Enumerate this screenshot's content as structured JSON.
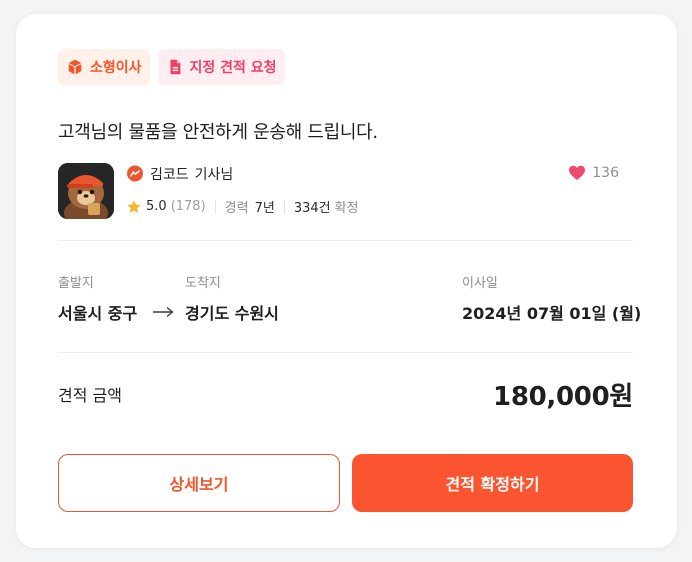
{
  "tags": {
    "move_type": "소형이사",
    "request_type": "지정 견적 요청"
  },
  "headline": "고객님의 물품을 안전하게 운송해 드립니다.",
  "driver": {
    "name": "김코드",
    "title": "기사님",
    "rating": "5.0",
    "rating_count": "(178)",
    "career_label": "경력",
    "career_value": "7년",
    "confirmed_count": "334건",
    "confirmed_label": "확정",
    "likes": "136"
  },
  "route": {
    "departure_label": "출발지",
    "departure_value": "서울시 중구",
    "arrival_label": "도착지",
    "arrival_value": "경기도 수원시",
    "date_label": "이사일",
    "date_value": "2024년 07월 01일 (월)"
  },
  "price": {
    "label": "견적 금액",
    "value": "180,000원"
  },
  "buttons": {
    "detail": "상세보기",
    "confirm": "견적 확정하기"
  },
  "colors": {
    "accent": "#fa5530",
    "tag_orange_bg": "#fff0ea",
    "tag_pink_bg": "#ffeef1",
    "heart": "#ef4a6e",
    "star": "#f7b731"
  },
  "icons": {
    "move_type": "box-icon",
    "request_type": "document-icon",
    "driver_badge": "chat-badge-icon",
    "rating": "star-icon",
    "likes": "heart-icon",
    "route": "arrow-right-icon"
  }
}
